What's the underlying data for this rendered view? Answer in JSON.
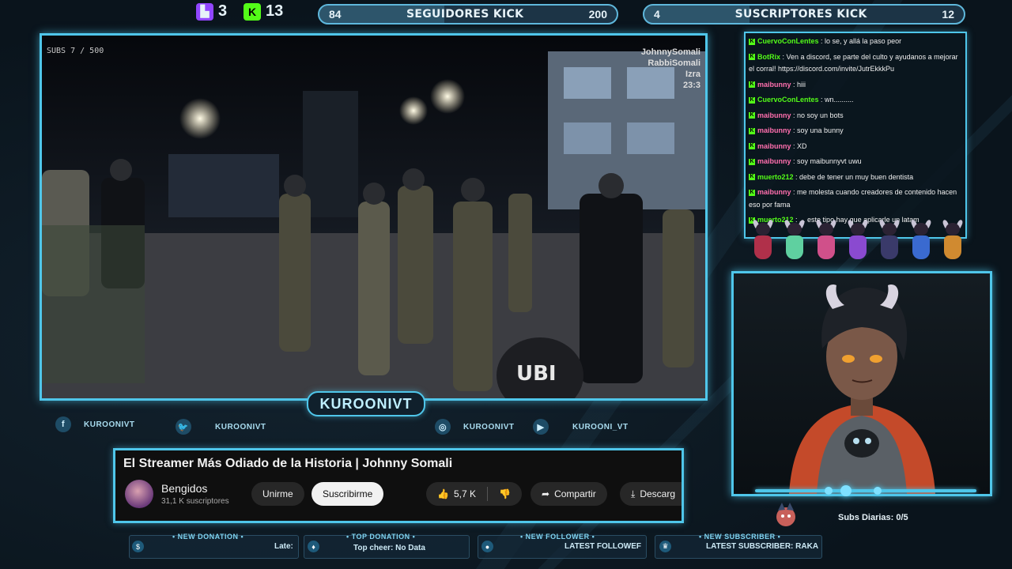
{
  "top": {
    "twitch": {
      "icon": "twitch-icon",
      "count": "3",
      "color": "#9146ff"
    },
    "kick": {
      "icon": "kick-icon",
      "count": "13",
      "color": "#53fc18"
    },
    "followers_goal": {
      "current": "84",
      "title": "SEGUIDORES KICK",
      "target": "200",
      "progress": 0.42
    },
    "subs_goal": {
      "current": "4",
      "title": "SUSCRIPTORES KICK",
      "target": "12",
      "progress": 0.33
    }
  },
  "video": {
    "subs_overlay": "SUBS 7 / 500",
    "watermark": [
      "JohnnySomali",
      "RabbiSomali",
      "Izra",
      "23:3"
    ],
    "vest_text": "UBI"
  },
  "channel_tag": "KUROONIVT",
  "socials": [
    {
      "icon": "facebook-icon",
      "label": "KUROONIVT"
    },
    {
      "icon": "twitter-icon",
      "label": "KUROONIVT"
    },
    {
      "icon": "instagram-icon",
      "label": "KUROONIVT"
    },
    {
      "icon": "youtube-icon",
      "label": "KUROONI_VT"
    }
  ],
  "youtube": {
    "title": "El Streamer Más Odiado de la Historia | Johnny Somali",
    "channel": "Bengidos",
    "subscribers": "31,1 K suscriptores",
    "join": "Unirme",
    "subscribe": "Suscribirme",
    "likes": "5,7 K",
    "share": "Compartir",
    "download": "Descarg"
  },
  "events": [
    {
      "icon": "dollar-icon",
      "label": "• NEW DONATION •",
      "value": "Late:"
    },
    {
      "icon": "drop-icon",
      "label": "• TOP DONATION •",
      "value": "Top cheer: No Data"
    },
    {
      "icon": "user-icon",
      "label": "• NEW FOLLOWER •",
      "value": "LATEST FOLLOWEF"
    },
    {
      "icon": "crown-icon",
      "label": "• NEW SUBSCRIBER •",
      "value": "LATEST SUBSCRIBER: RAKA"
    }
  ],
  "chat": [
    {
      "user": "CuervoConLentes",
      "color": "#53fc18",
      "text": "lo se, y allá la paso peor"
    },
    {
      "user": "BotRix",
      "color": "#53fc18",
      "text": "Ven a discord, se parte del culto y ayudanos a mejorar el corral! https://discord.com/invite/JutrEkkkPu"
    },
    {
      "user": "maibunny",
      "color": "#ff6fae",
      "text": "hiii"
    },
    {
      "user": "CuervoConLentes",
      "color": "#53fc18",
      "text": "wn.........."
    },
    {
      "user": "maibunny",
      "color": "#ff6fae",
      "text": "no soy un bots"
    },
    {
      "user": "maibunny",
      "color": "#ff6fae",
      "text": "soy una bunny"
    },
    {
      "user": "maibunny",
      "color": "#ff6fae",
      "text": "XD"
    },
    {
      "user": "maibunny",
      "color": "#ff6fae",
      "text": "soy maibunnyvt uwu"
    },
    {
      "user": "muerto212",
      "color": "#53fc18",
      "text": "debe de tener un muy buen dentista"
    },
    {
      "user": "maibunny",
      "color": "#ff6fae",
      "text": "me molesta cuando creadores de contenido hacen eso por fama"
    },
    {
      "user": "muerto212",
      "color": "#53fc18",
      "text": "... este tipo hay que aplicarle un latam"
    }
  ],
  "subs_daily": "Subs Diarias:  0/5",
  "colors": {
    "accent": "#4fc6ea",
    "background": "#0b1620"
  }
}
